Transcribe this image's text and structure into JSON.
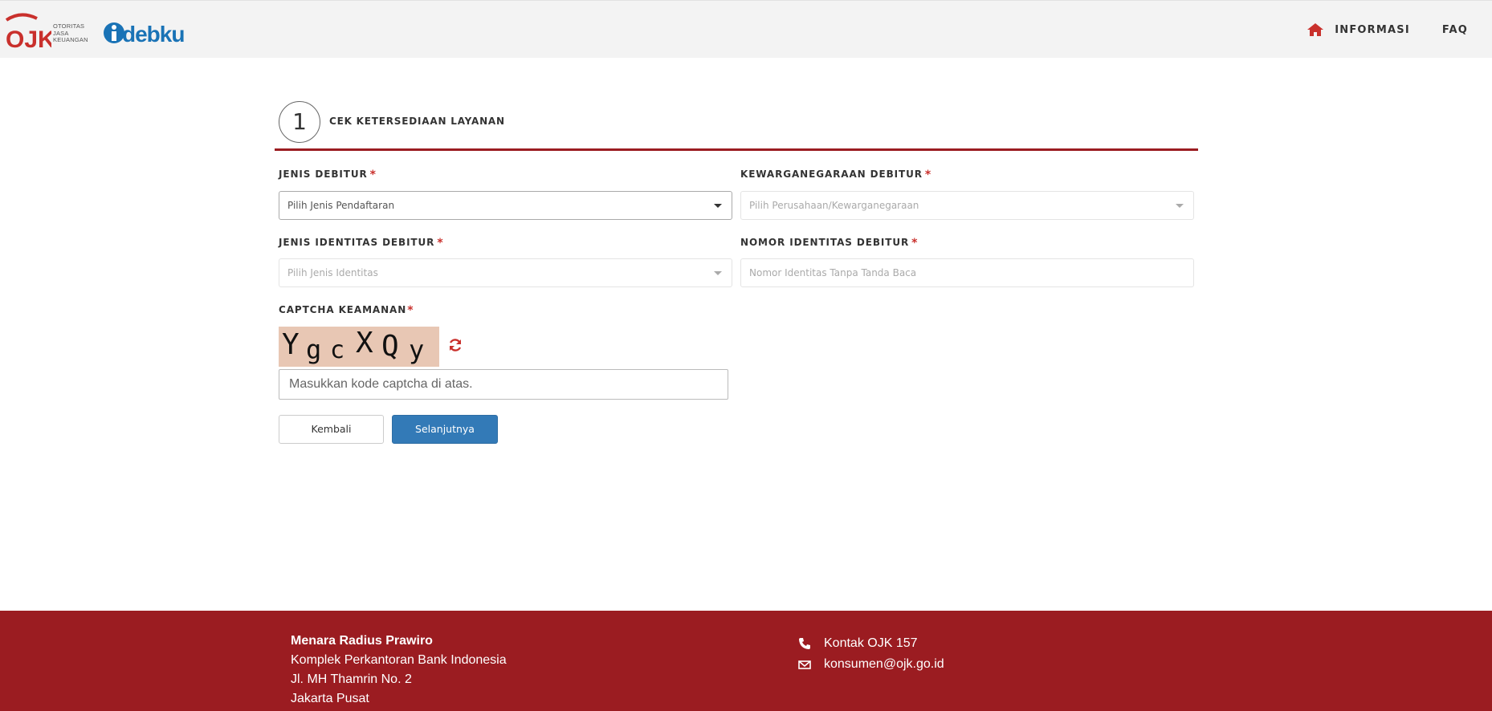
{
  "header": {
    "ojk_logo_text": [
      "OTORITAS",
      "JASA",
      "KEUANGAN"
    ],
    "ojk_mark": "OJK",
    "app_logo": "debku",
    "nav": {
      "informasi": "INFORMASI",
      "faq": "FAQ"
    }
  },
  "step": {
    "number": "1",
    "title": "CEK KETERSEDIAAN LAYANAN"
  },
  "form": {
    "jenis_debitur": {
      "label": "JENIS DEBITUR",
      "placeholder": "Pilih Jenis Pendaftaran"
    },
    "kewarganegaraan": {
      "label": "KEWARGANEGARAAN DEBITUR",
      "placeholder": "Pilih Perusahaan/Kewarganegaraan"
    },
    "jenis_identitas": {
      "label": "JENIS IDENTITAS DEBITUR",
      "placeholder": "Pilih Jenis Identitas"
    },
    "nomor_identitas": {
      "label": "NOMOR IDENTITAS DEBITUR",
      "placeholder": "Nomor Identitas Tanpa Tanda Baca"
    },
    "captcha": {
      "label": "CAPTCHA KEAMANAN",
      "chars": [
        "Y",
        "g",
        "c",
        "X",
        "Q",
        "y"
      ],
      "input_placeholder": "Masukkan kode captcha di atas."
    },
    "required_mark": "*"
  },
  "buttons": {
    "back": "Kembali",
    "next": "Selanjutnya"
  },
  "footer": {
    "address": [
      "Menara Radius Prawiro",
      "Komplek Perkantoran Bank Indonesia",
      "Jl. MH Thamrin No. 2",
      "Jakarta Pusat"
    ],
    "phone": "Kontak OJK 157",
    "email": "konsumen@ojk.go.id"
  },
  "colors": {
    "brand_red": "#9b1c21",
    "primary_blue": "#337ab7",
    "required": "#c9302c"
  }
}
